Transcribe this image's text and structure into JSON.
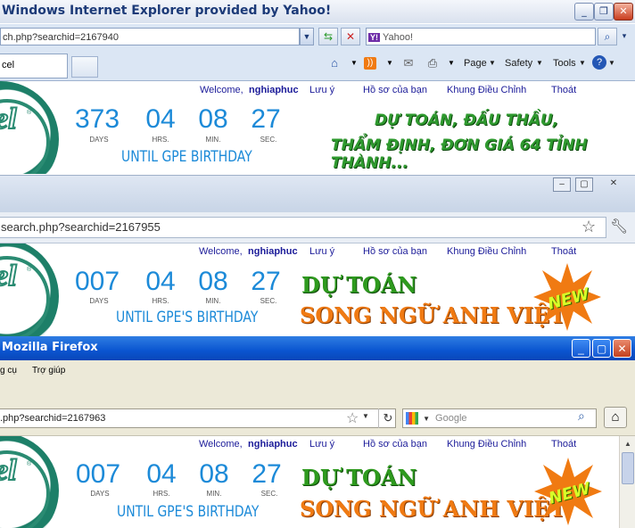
{
  "ie": {
    "title": "Windows Internet Explorer provided by Yahoo!",
    "address": "ch.php?searchid=2167940",
    "search_placeholder": "Yahoo!",
    "yahoo_badge": "Y!",
    "tab_label": "cel",
    "commands": {
      "page": "Page",
      "safety": "Safety",
      "tools": "Tools"
    },
    "header": {
      "nav": {
        "welcome": "Welcome,",
        "user": "nghiaphuc",
        "saved": "Lưu ý",
        "profile": "Hồ sơ của bạn",
        "control_panel": "Khung Điều Chỉnh",
        "logout": "Thoát"
      },
      "countdown": {
        "days": "373",
        "hrs": "04",
        "min": "08",
        "sec": "27",
        "days_lbl": "DAYS",
        "hrs_lbl": "HRS.",
        "min_lbl": "MIN.",
        "sec_lbl": "SEC."
      },
      "until": "UNTIL GPE BIRTHDAY",
      "promo_line1": "DỰ TOÁN, ĐẤU THẦU,",
      "promo_line2": "THẨM ĐỊNH, ĐƠN GIÁ 64 TỈNH THÀNH..."
    }
  },
  "chrome": {
    "address": "search.php?searchid=2167955",
    "header": {
      "nav": {
        "welcome": "Welcome,",
        "user": "nghiaphuc",
        "saved": "Lưu ý",
        "profile": "Hồ sơ của bạn",
        "control_panel": "Khung Điều Chỉnh",
        "logout": "Thoát"
      },
      "countdown": {
        "days": "007",
        "hrs": "04",
        "min": "08",
        "sec": "27",
        "days_lbl": "DAYS",
        "hrs_lbl": "HRS.",
        "min_lbl": "MIN.",
        "sec_lbl": "SEC."
      },
      "until": "UNTIL GPE'S BIRTHDAY",
      "promo_line1": "DỰ TOÁN",
      "promo_line2": "SONG NGỮ ANH VIỆT",
      "new_badge": "NEW"
    }
  },
  "firefox": {
    "title": "Mozilla Firefox",
    "menu": {
      "tools": "g cụ",
      "help": "Trợ giúp"
    },
    "address": ".php?searchid=2167963",
    "search_placeholder": "Google",
    "header": {
      "nav": {
        "welcome": "Welcome,",
        "user": "nghiaphuc",
        "saved": "Lưu ý",
        "profile": "Hồ sơ của bạn",
        "control_panel": "Khung Điều Chỉnh",
        "logout": "Thoát"
      },
      "countdown": {
        "days": "007",
        "hrs": "04",
        "min": "08",
        "sec": "27",
        "days_lbl": "DAYS",
        "hrs_lbl": "HRS.",
        "min_lbl": "MIN.",
        "sec_lbl": "SEC."
      },
      "until": "UNTIL GPE'S BIRTHDAY",
      "promo_line1": "DỰ TOÁN",
      "promo_line2": "SONG NGỮ ANH VIỆT",
      "new_badge": "NEW"
    }
  },
  "colors": {
    "countdown": "#1c8ad8",
    "nav_link": "#1b1b99",
    "promo_green": "#2e9a1e",
    "promo_orange": "#f07a12",
    "xp_title": "#0a55d0"
  }
}
